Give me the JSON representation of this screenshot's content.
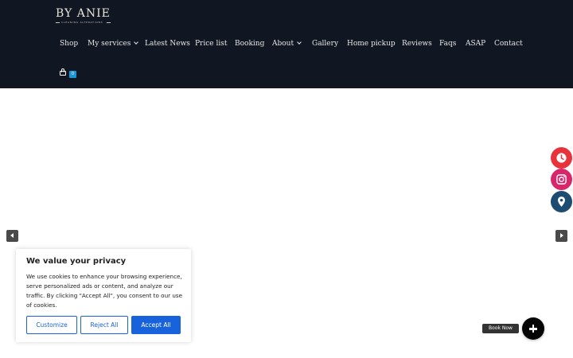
{
  "brand": {
    "name": "BY ANIE",
    "tagline": "CLEANING ALTERATIONS"
  },
  "nav": {
    "items": [
      {
        "label": "Shop",
        "has_dropdown": false
      },
      {
        "label": "My services",
        "has_dropdown": true
      },
      {
        "label": "Latest News",
        "has_dropdown": false
      },
      {
        "label": "Price list",
        "has_dropdown": false
      },
      {
        "label": "Booking",
        "has_dropdown": false
      },
      {
        "label": "About",
        "has_dropdown": true
      },
      {
        "label": "Gallery",
        "has_dropdown": false
      },
      {
        "label": "Home pickup",
        "has_dropdown": false
      },
      {
        "label": "Reviews",
        "has_dropdown": false
      },
      {
        "label": "Faqs",
        "has_dropdown": false
      },
      {
        "label": "ASAP",
        "has_dropdown": false
      },
      {
        "label": "Contact",
        "has_dropdown": false
      }
    ]
  },
  "cart": {
    "count": "0",
    "icon": "shopping-bag-icon"
  },
  "slider": {
    "prev_icon": "arrow-left-icon",
    "next_icon": "arrow-right-icon"
  },
  "floating": {
    "clock": {
      "icon": "clock-icon",
      "color": "#e8333a"
    },
    "instagram": {
      "icon": "instagram-icon",
      "color": "#d8266b"
    },
    "location": {
      "icon": "map-pin-icon",
      "color": "#1d4c73"
    }
  },
  "cookie": {
    "title": "We value your privacy",
    "text": "We use cookies to enhance your browsing experience, serve personalized ads or content, and analyze our traffic. By clicking \"Accept All\", you consent to our use of cookies.",
    "customize": "Customize",
    "reject": "Reject All",
    "accept": "Accept All",
    "accent_color": "#1863dc"
  },
  "book": {
    "label": "Book Now",
    "icon": "plus-icon"
  },
  "colors": {
    "header_bg": "#101722"
  }
}
